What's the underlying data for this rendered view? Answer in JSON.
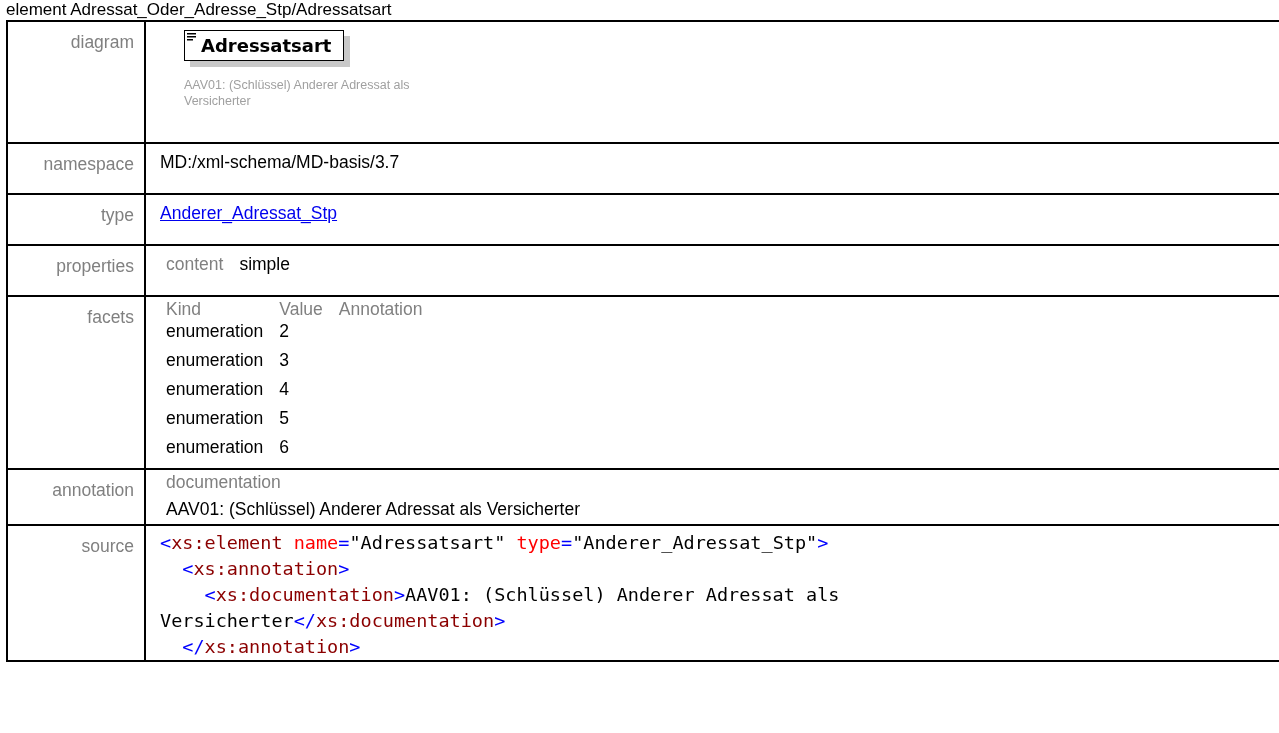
{
  "title": "element Adressat_Oder_Adresse_Stp/Adressatsart",
  "diagram": {
    "label": "diagram",
    "element_name": "Adressatsart",
    "annotation": "AAV01: (Schlüssel) Anderer Adressat als Versicherter"
  },
  "namespace": {
    "label": "namespace",
    "value": "MD:/xml-schema/MD-basis/3.7"
  },
  "type": {
    "label": "type",
    "value": "Anderer_Adressat_Stp"
  },
  "properties": {
    "label": "properties",
    "items": [
      {
        "name": "content",
        "value": "simple"
      }
    ]
  },
  "facets": {
    "label": "facets",
    "columns": [
      "Kind",
      "Value",
      "Annotation"
    ],
    "rows": [
      {
        "kind": "enumeration",
        "value": "2"
      },
      {
        "kind": "enumeration",
        "value": "3"
      },
      {
        "kind": "enumeration",
        "value": "4"
      },
      {
        "kind": "enumeration",
        "value": "5"
      },
      {
        "kind": "enumeration",
        "value": "6"
      }
    ]
  },
  "annotation": {
    "label": "annotation",
    "heading": "documentation",
    "text": "AAV01: (Schlüssel) Anderer Adressat als Versicherter"
  },
  "source": {
    "label": "source",
    "lines": [
      [
        {
          "kind": "punct",
          "text": "<"
        },
        {
          "kind": "tag",
          "text": "xs:element"
        },
        {
          "kind": "attr",
          "text": " name"
        },
        {
          "kind": "punct",
          "text": "="
        },
        {
          "kind": "text",
          "text": "\"Adressatsart\""
        },
        {
          "kind": "attr",
          "text": " type"
        },
        {
          "kind": "punct",
          "text": "="
        },
        {
          "kind": "text",
          "text": "\"Anderer_Adressat_Stp\""
        },
        {
          "kind": "punct",
          "text": ">"
        }
      ],
      [
        {
          "kind": "punct",
          "text": "  <"
        },
        {
          "kind": "tag",
          "text": "xs:annotation"
        },
        {
          "kind": "punct",
          "text": ">"
        }
      ],
      [
        {
          "kind": "punct",
          "text": "    <"
        },
        {
          "kind": "tag",
          "text": "xs:documentation"
        },
        {
          "kind": "punct",
          "text": ">"
        },
        {
          "kind": "text",
          "text": "AAV01: (Schlüssel) Anderer Adressat als"
        }
      ],
      [
        {
          "kind": "text",
          "text": "Versicherter"
        },
        {
          "kind": "punct",
          "text": "</"
        },
        {
          "kind": "tag",
          "text": "xs:documentation"
        },
        {
          "kind": "punct",
          "text": ">"
        }
      ],
      [
        {
          "kind": "punct",
          "text": "  </"
        },
        {
          "kind": "tag",
          "text": "xs:annotation"
        },
        {
          "kind": "punct",
          "text": ">"
        }
      ]
    ]
  }
}
